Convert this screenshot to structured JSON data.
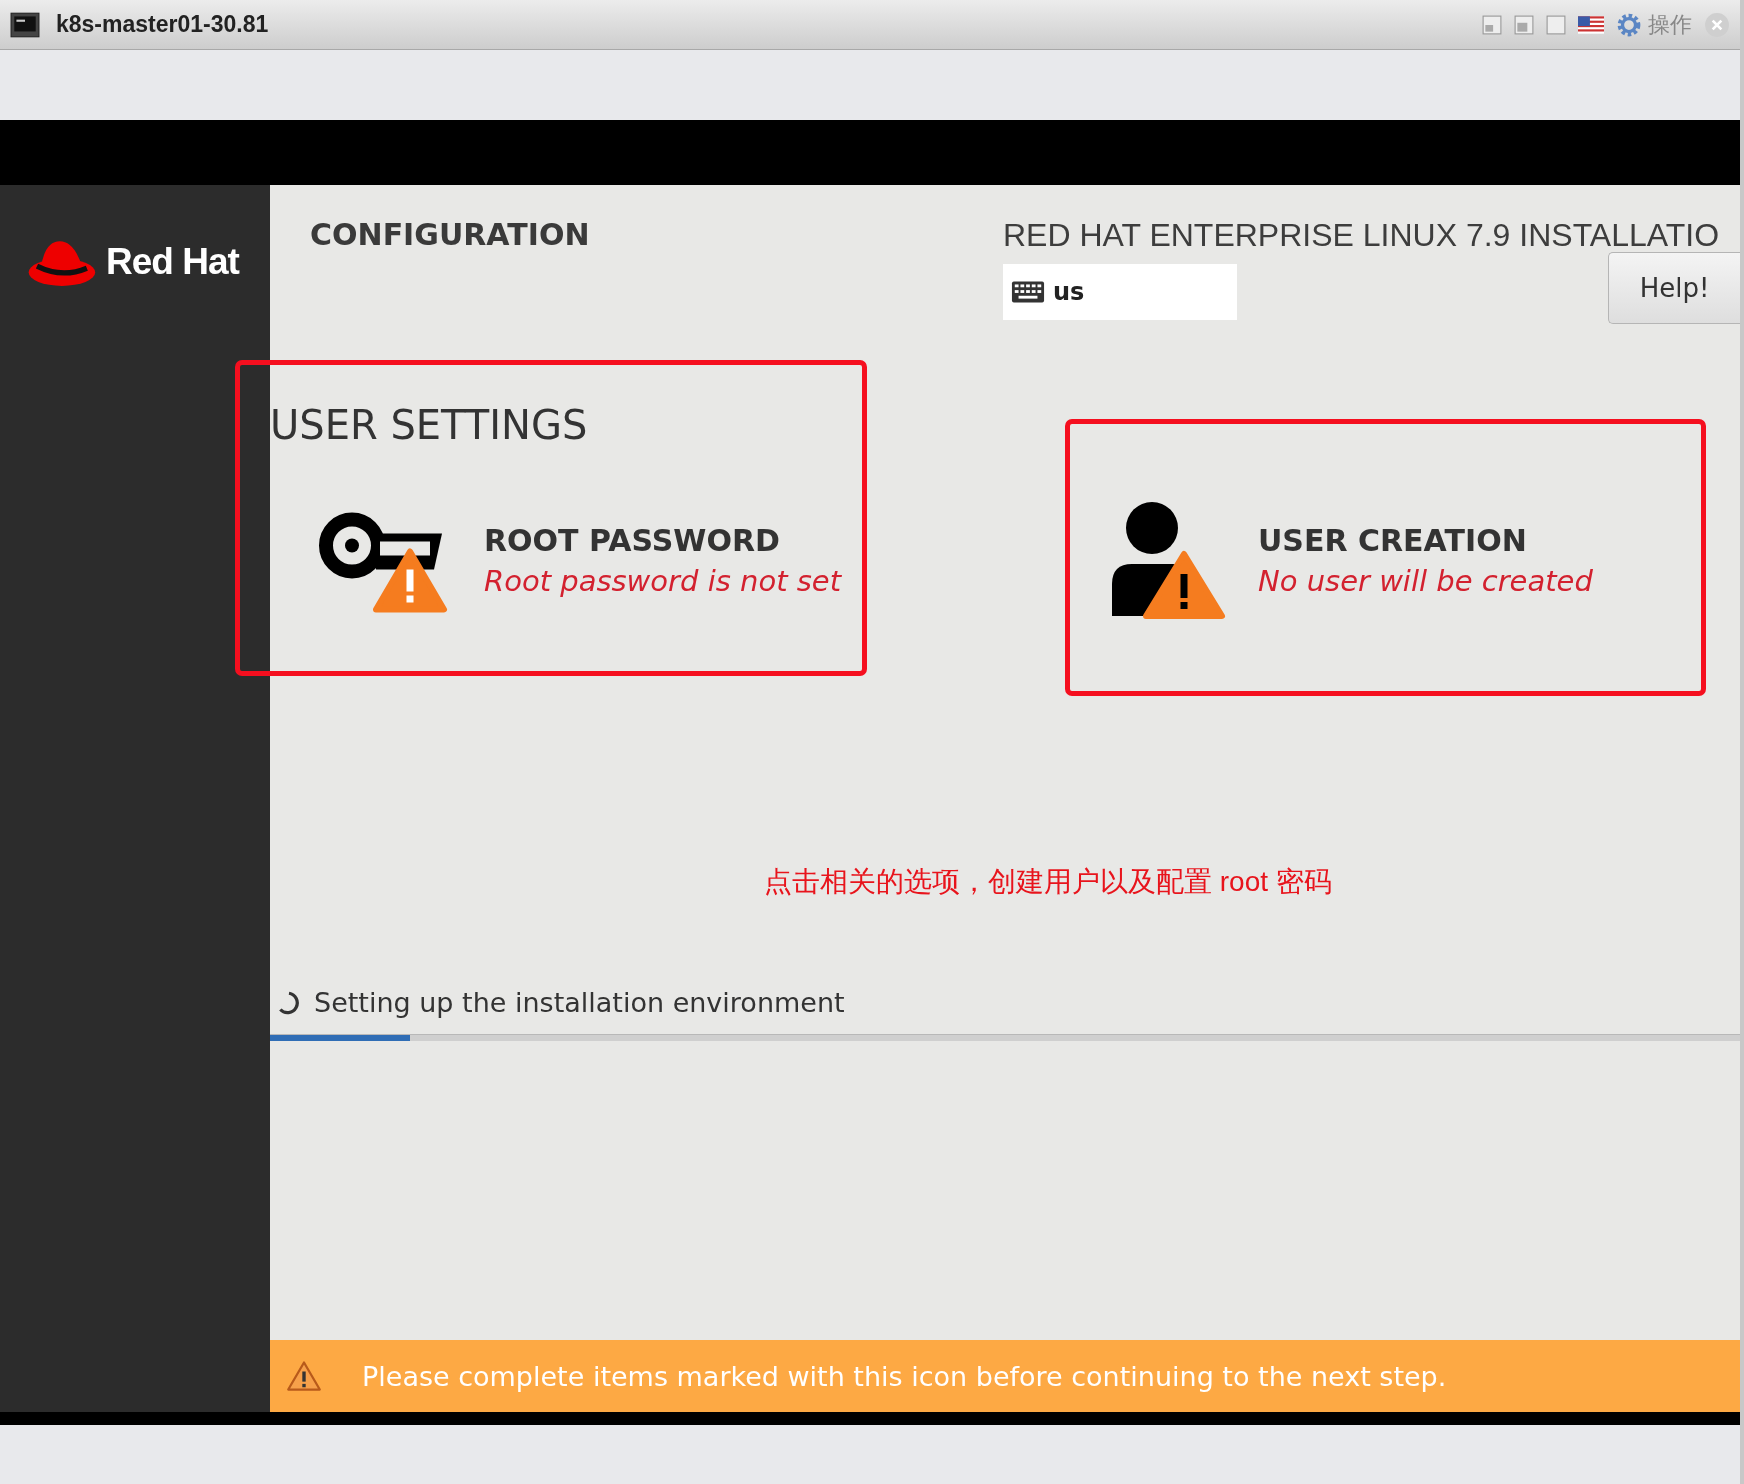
{
  "window": {
    "title": "k8s-master01-30.81",
    "menu_label": "操作"
  },
  "sidebar": {
    "logo_text": "Red Hat"
  },
  "header": {
    "section": "CONFIGURATION",
    "product": "RED HAT ENTERPRISE LINUX 7.9 INSTALLATIO",
    "keyboard_layout": "us",
    "help_button": "Help!"
  },
  "hub": {
    "category": "USER SETTINGS",
    "spokes": [
      {
        "kind": "root",
        "title": "ROOT PASSWORD",
        "status": "Root password is not set",
        "warning": true
      },
      {
        "kind": "user",
        "title": "USER CREATION",
        "status": "No user will be created",
        "warning": true
      }
    ]
  },
  "annotation": "点击相关的选项，创建用户以及配置 root 密码",
  "progress": {
    "message": "Setting up the installation environment",
    "level": 0.095
  },
  "warning_bar": {
    "message": "Please complete items marked with this icon before continuing to the next step."
  }
}
